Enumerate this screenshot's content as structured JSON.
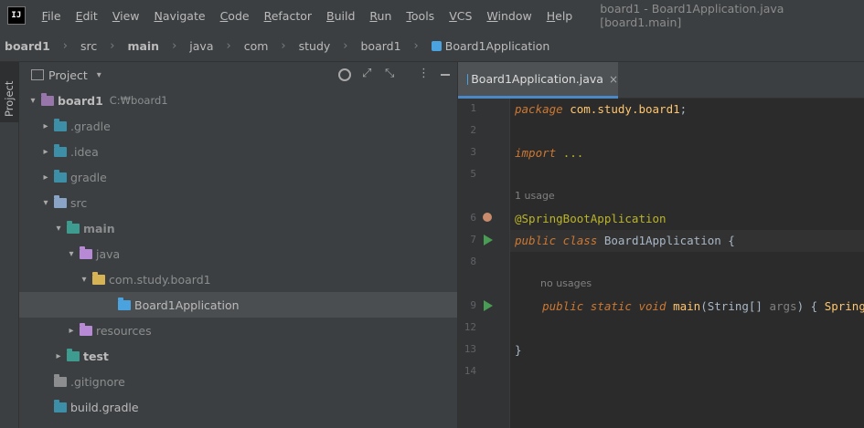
{
  "menubar": {
    "logo_text": "IJ",
    "items": [
      "File",
      "Edit",
      "View",
      "Navigate",
      "Code",
      "Refactor",
      "Build",
      "Run",
      "Tools",
      "VCS",
      "Window",
      "Help"
    ],
    "window_title": "board1 - Board1Application.java [board1.main]"
  },
  "breadcrumbs": [
    "board1",
    "src",
    "main",
    "java",
    "com",
    "study",
    "board1",
    "Board1Application"
  ],
  "left_strip": {
    "project_tab": "Project"
  },
  "project_panel": {
    "title": "Project",
    "tree": [
      {
        "label": "board1",
        "hint": "C:₩board1",
        "arrow": "▾",
        "color": "#9876aa",
        "bold": true
      },
      {
        "label": ".gradle",
        "arrow": "▸",
        "color": "#3d8fa8",
        "excluded": true
      },
      {
        "label": ".idea",
        "arrow": "▸",
        "color": "#3d8fa8",
        "excluded": true
      },
      {
        "label": "gradle",
        "arrow": "▸",
        "color": "#3d8fa8",
        "excluded": true
      },
      {
        "label": "src",
        "arrow": "▾",
        "color": "#8aa4c8",
        "excluded": true
      },
      {
        "label": "main",
        "arrow": "▾",
        "color": "#3d9b8f",
        "bold": true,
        "excluded": true
      },
      {
        "label": "java",
        "arrow": "▾",
        "color": "#b88ad6",
        "excluded": true
      },
      {
        "label": "com.study.board1",
        "arrow": "▾",
        "color": "#d6b455",
        "excluded": true
      },
      {
        "label": "Board1Application",
        "arrow": "",
        "color": "#4aa3df",
        "selected": true
      },
      {
        "label": "resources",
        "arrow": "▸",
        "color": "#b88ad6",
        "excluded": true
      },
      {
        "label": "test",
        "arrow": "▸",
        "color": "#3d9b8f",
        "bold": true
      },
      {
        "label": ".gitignore",
        "arrow": "",
        "color": "#8b8d8e",
        "excluded": true
      },
      {
        "label": "build.gradle",
        "arrow": "",
        "color": "#3d8fa8"
      }
    ]
  },
  "editor": {
    "tab_label": "Board1Application.java",
    "lines": [
      {
        "no": "1",
        "parts": [
          [
            "kw",
            "package "
          ],
          [
            "cls",
            "com.study.board1"
          ],
          [
            "",
            "; "
          ]
        ]
      },
      {
        "no": "2",
        "parts": []
      },
      {
        "no": "3",
        "parts": [
          [
            "kw",
            "import "
          ],
          [
            "ann",
            "..."
          ]
        ]
      },
      {
        "no": "5",
        "parts": []
      },
      {
        "inlay": "1 usage"
      },
      {
        "no": "6",
        "parts": [
          [
            "ann",
            "@SpringBootApplication"
          ]
        ]
      },
      {
        "no": "7",
        "parts": [
          [
            "kw",
            "public class "
          ],
          [
            "",
            "Board1Application"
          ],
          [
            "",
            " {"
          ]
        ]
      },
      {
        "no": "8",
        "parts": []
      },
      {
        "inlay": "no usages"
      },
      {
        "no": "9",
        "parts": [
          [
            "kw",
            "    public static void "
          ],
          [
            "cls",
            "main"
          ],
          [
            "",
            "(String[] "
          ],
          [
            "param",
            "args"
          ],
          [
            "",
            ") { "
          ],
          [
            "cls",
            "SpringAppl"
          ]
        ]
      },
      {
        "no": "12",
        "parts": []
      },
      {
        "no": "13",
        "parts": [
          [
            "",
            "}"
          ]
        ]
      },
      {
        "no": "14",
        "parts": []
      }
    ]
  }
}
